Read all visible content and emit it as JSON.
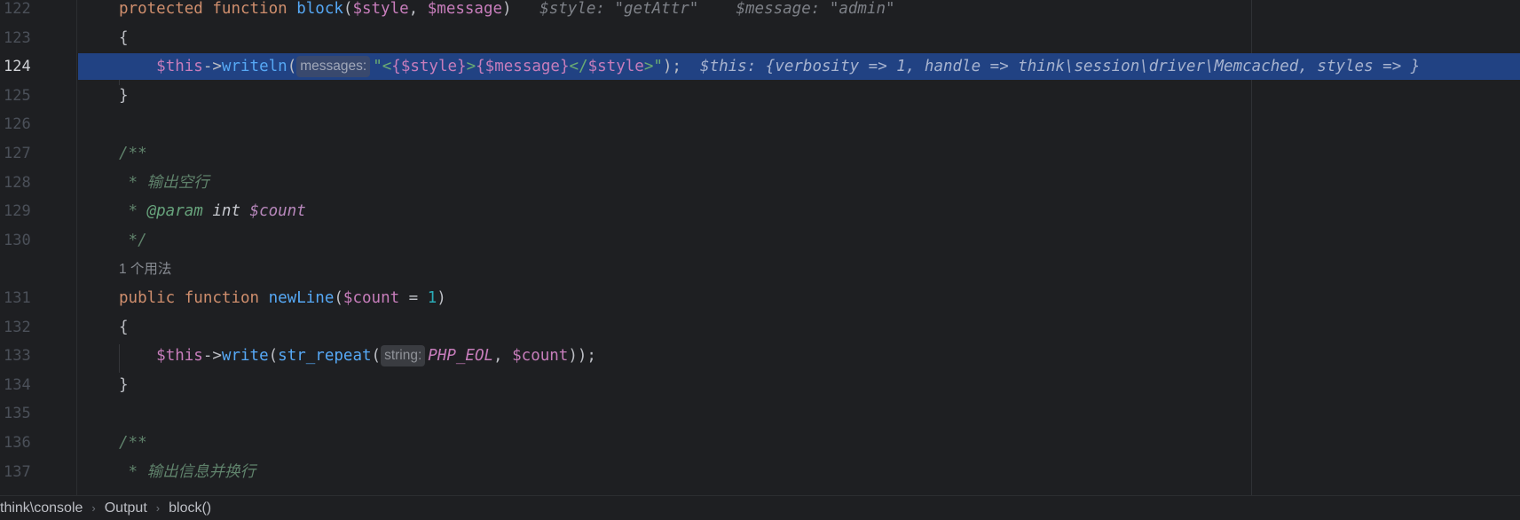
{
  "editor": {
    "lines": [
      {
        "num": "122",
        "parts": [
          {
            "t": "protected",
            "c": "kw"
          },
          {
            "t": " ",
            "c": "plain"
          },
          {
            "t": "function",
            "c": "kw"
          },
          {
            "t": " ",
            "c": "plain"
          },
          {
            "t": "block",
            "c": "fn"
          },
          {
            "t": "(",
            "c": "plain"
          },
          {
            "t": "$style",
            "c": "var"
          },
          {
            "t": ", ",
            "c": "plain"
          },
          {
            "t": "$message",
            "c": "var"
          },
          {
            "t": ")",
            "c": "plain"
          },
          {
            "t": "   $style: \"getAttr\"    $message: \"admin\"",
            "c": "inline-val"
          }
        ]
      },
      {
        "num": "123",
        "parts": [
          {
            "t": "{",
            "c": "plain"
          }
        ]
      },
      {
        "num": "124",
        "current": true,
        "parts": [
          {
            "t": "    ",
            "c": "plain"
          },
          {
            "t": "$this",
            "c": "var"
          },
          {
            "t": "->",
            "c": "plain"
          },
          {
            "t": "writeln",
            "c": "fn"
          },
          {
            "t": "(",
            "c": "plain"
          },
          {
            "t": "messages:",
            "c": "hint"
          },
          {
            "t": "\"<",
            "c": "str"
          },
          {
            "t": "{",
            "c": "var"
          },
          {
            "t": "$style",
            "c": "var"
          },
          {
            "t": "}",
            "c": "var"
          },
          {
            "t": ">",
            "c": "str"
          },
          {
            "t": "{",
            "c": "var"
          },
          {
            "t": "$message",
            "c": "var"
          },
          {
            "t": "}",
            "c": "var"
          },
          {
            "t": "</",
            "c": "str"
          },
          {
            "t": "$style",
            "c": "var"
          },
          {
            "t": ">\"",
            "c": "str"
          },
          {
            "t": ");",
            "c": "plain"
          },
          {
            "t": "  $this: {verbosity => 1, handle => think\\session\\driver\\Memcached, styles => }",
            "c": "inline-val"
          }
        ]
      },
      {
        "num": "125",
        "parts": [
          {
            "t": "}",
            "c": "plain"
          }
        ]
      },
      {
        "num": "126",
        "parts": []
      },
      {
        "num": "127",
        "parts": [
          {
            "t": "/**",
            "c": "cmt"
          }
        ]
      },
      {
        "num": "128",
        "parts": [
          {
            "t": " * 输出空行",
            "c": "cmt"
          }
        ]
      },
      {
        "num": "129",
        "parts": [
          {
            "t": " * ",
            "c": "cmt"
          },
          {
            "t": "@param",
            "c": "cmt-tag"
          },
          {
            "t": " ",
            "c": "cmt"
          },
          {
            "t": "int",
            "c": "cmt-type"
          },
          {
            "t": " ",
            "c": "cmt"
          },
          {
            "t": "$count",
            "c": "cmt-var"
          }
        ]
      },
      {
        "num": "130",
        "parts": [
          {
            "t": " */",
            "c": "cmt"
          }
        ]
      },
      {
        "num": "",
        "parts": [
          {
            "t": "1 个用法",
            "c": "usages"
          }
        ]
      },
      {
        "num": "131",
        "parts": [
          {
            "t": "public",
            "c": "kw"
          },
          {
            "t": " ",
            "c": "plain"
          },
          {
            "t": "function",
            "c": "kw"
          },
          {
            "t": " ",
            "c": "plain"
          },
          {
            "t": "newLine",
            "c": "fn"
          },
          {
            "t": "(",
            "c": "plain"
          },
          {
            "t": "$count",
            "c": "var"
          },
          {
            "t": " = ",
            "c": "plain"
          },
          {
            "t": "1",
            "c": "num"
          },
          {
            "t": ")",
            "c": "plain"
          }
        ]
      },
      {
        "num": "132",
        "parts": [
          {
            "t": "{",
            "c": "plain"
          }
        ]
      },
      {
        "num": "133",
        "parts": [
          {
            "t": "    ",
            "c": "plain"
          },
          {
            "t": "$this",
            "c": "var"
          },
          {
            "t": "->",
            "c": "plain"
          },
          {
            "t": "write",
            "c": "fn"
          },
          {
            "t": "(",
            "c": "plain"
          },
          {
            "t": "str_repeat",
            "c": "fn"
          },
          {
            "t": "(",
            "c": "plain"
          },
          {
            "t": "string:",
            "c": "hint"
          },
          {
            "t": "PHP_EOL",
            "c": "const"
          },
          {
            "t": ", ",
            "c": "plain"
          },
          {
            "t": "$count",
            "c": "var"
          },
          {
            "t": "));",
            "c": "plain"
          }
        ]
      },
      {
        "num": "134",
        "parts": [
          {
            "t": "}",
            "c": "plain"
          }
        ]
      },
      {
        "num": "135",
        "parts": []
      },
      {
        "num": "136",
        "parts": [
          {
            "t": "/**",
            "c": "cmt"
          }
        ]
      },
      {
        "num": "137",
        "parts": [
          {
            "t": " * 输出信息并换行",
            "c": "cmt"
          }
        ]
      }
    ]
  },
  "breadcrumb": [
    "think\\console",
    "Output",
    "block()"
  ],
  "colors": {
    "background": "#1e1f22",
    "current_line": "#214283",
    "keyword": "#cf8e6d",
    "function": "#56a8f5",
    "variable": "#c77dbb",
    "string": "#6aab73",
    "comment": "#5f826b"
  }
}
